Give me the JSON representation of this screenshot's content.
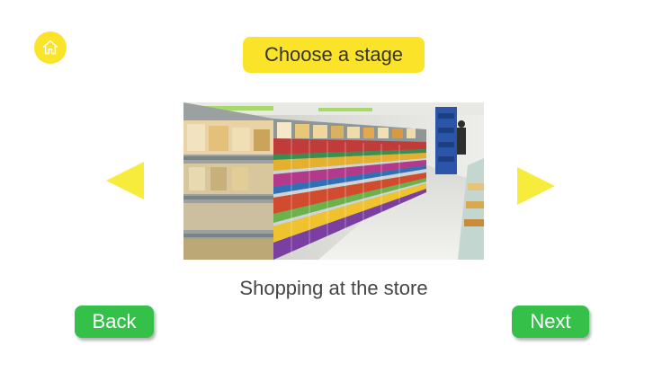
{
  "colors": {
    "accent_yellow": "#fbe32a",
    "arrow_yellow": "#f7ec3c",
    "button_green": "#35c04a",
    "text_dark": "#333333"
  },
  "header": {
    "home_icon": "home-icon",
    "title": "Choose a stage"
  },
  "carousel": {
    "prev_icon": "triangle-left-icon",
    "next_icon": "triangle-right-icon",
    "stage_caption": "Shopping at the store"
  },
  "footer": {
    "back_label": "Back",
    "next_label": "Next"
  }
}
